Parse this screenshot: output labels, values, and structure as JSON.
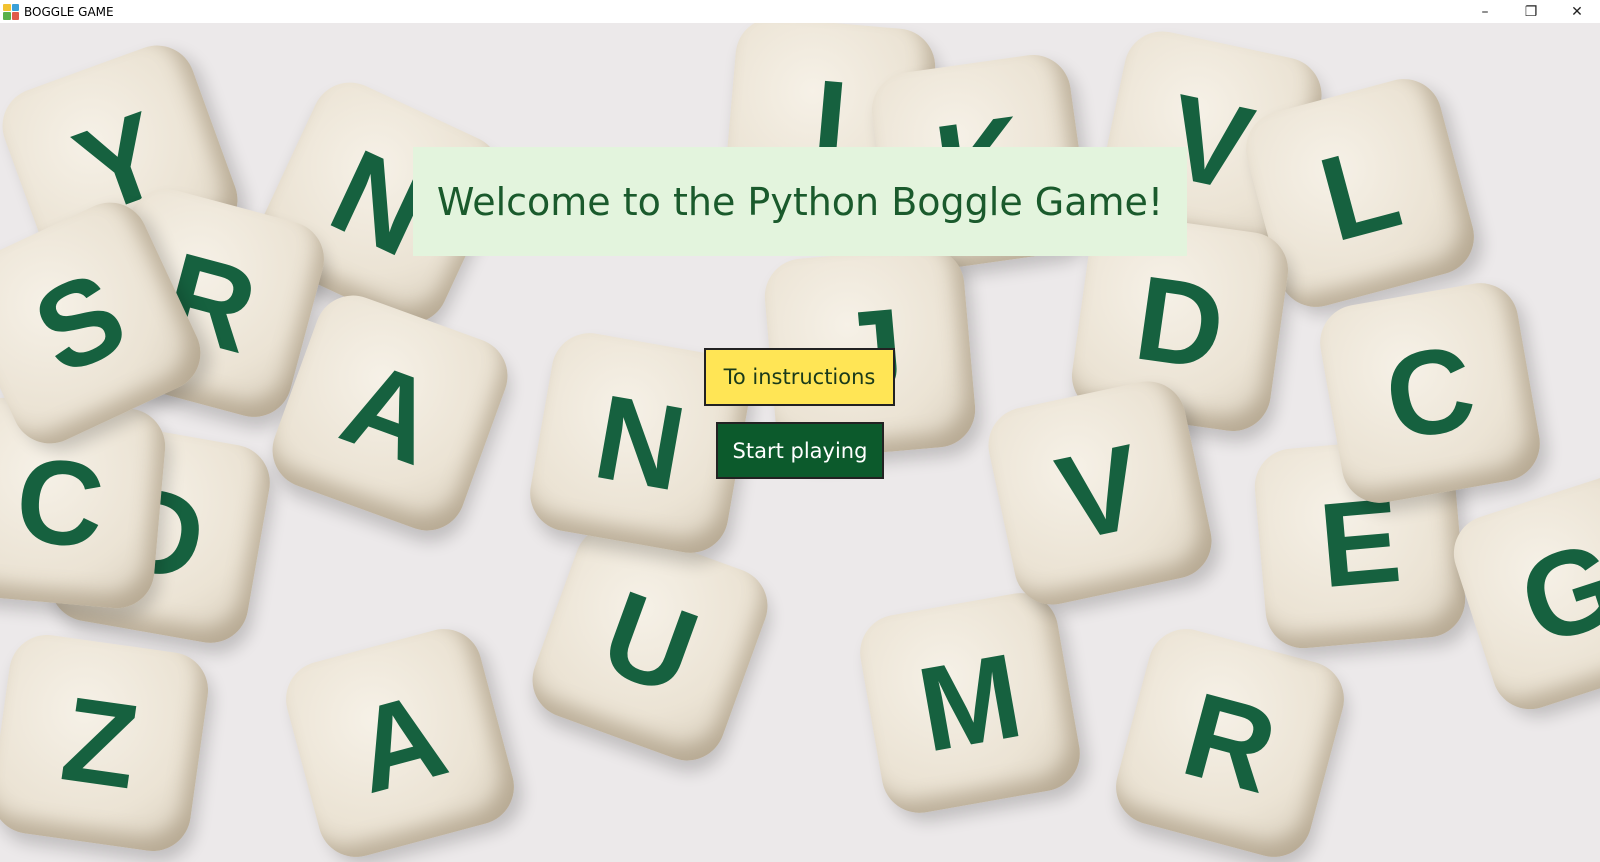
{
  "window": {
    "title": "BOGGLE GAME",
    "controls": [
      "minimize",
      "restore",
      "close"
    ]
  },
  "main": {
    "banner_text": "Welcome to the Python Boggle Game!",
    "instructions_button": "To instructions",
    "start_button": "Start playing"
  },
  "background": {
    "dice_letters": [
      "A",
      "D",
      "U",
      "M",
      "R",
      "E",
      "Y",
      "N",
      "I",
      "K",
      "V",
      "L",
      "R",
      "J",
      "D",
      "C",
      "A",
      "V",
      "C",
      "S",
      "N",
      "G",
      "Z"
    ]
  },
  "colors": {
    "letter_green": "#16613f",
    "banner_bg": "#e3f4dd",
    "banner_text": "#1a5a2c",
    "instructions_bg": "#ffe555",
    "start_bg": "#0c5a2c"
  }
}
